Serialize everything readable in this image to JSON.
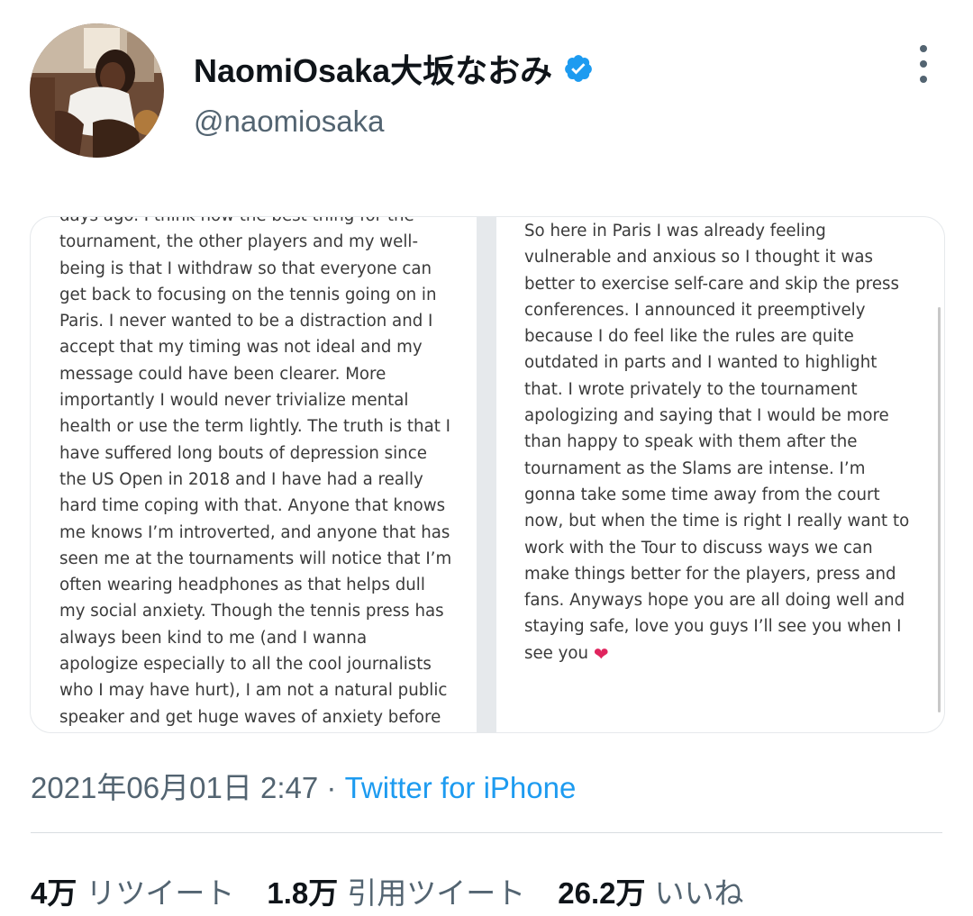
{
  "user": {
    "display_name": "NaomiOsaka大坂なおみ",
    "handle": "@naomiosaka",
    "verified_icon": "verified-badge-icon",
    "accent_color": "#1d9bf0"
  },
  "media": {
    "left_note": "days ago. I think now the best thing for the\ntournament, the other players and my well-\nbeing is that I withdraw so that everyone can\nget back to focusing on the tennis going on in\nParis. I never wanted to be a distraction and I\naccept that my timing was not ideal and my\nmessage could have been clearer. More\nimportantly I would never trivialize mental\nhealth or use the term lightly. The truth is that I\nhave suffered long bouts of depression since\nthe US Open in 2018 and I have had a really\nhard time coping with that. Anyone that knows\nme knows I’m introverted, and anyone that has\nseen me at the tournaments will notice that I’m\noften wearing headphones as that helps dull\nmy social anxiety. Though the tennis press has\nalways been kind to me (and I wanna\napologize especially to all the cool journalists\nwho I may have hurt), I am not a natural public\nspeaker and get huge waves of anxiety before",
    "right_note": "So here in Paris I was already feeling\nvulnerable and anxious so I thought it was\nbetter to exercise self-care and skip the press\nconferences. I announced it preemptively\nbecause I do feel like the rules are quite\noutdated in parts and I wanted to highlight\nthat. I wrote privately to the tournament\napologizing and saying that I would be more\nthan happy to speak with them after the\ntournament as the Slams are intense. I’m\ngonna take some time away from the court\nnow, but when the time is right I really want to\nwork with the Tour to discuss ways we can\nmake things better for the players, press and\nfans. Anyways hope you are all doing well and\nstaying safe, love you guys I’ll see you when I\nsee you ",
    "heart_emoji": "❤"
  },
  "meta": {
    "timestamp": "2021年06月01日 2:47",
    "separator": " · ",
    "source": "Twitter for iPhone"
  },
  "stats": {
    "retweets": {
      "value": "4万",
      "label": "リツイート"
    },
    "quotes": {
      "value": "1.8万",
      "label": "引用ツイート"
    },
    "likes": {
      "value": "26.2万",
      "label": "いいね"
    }
  }
}
